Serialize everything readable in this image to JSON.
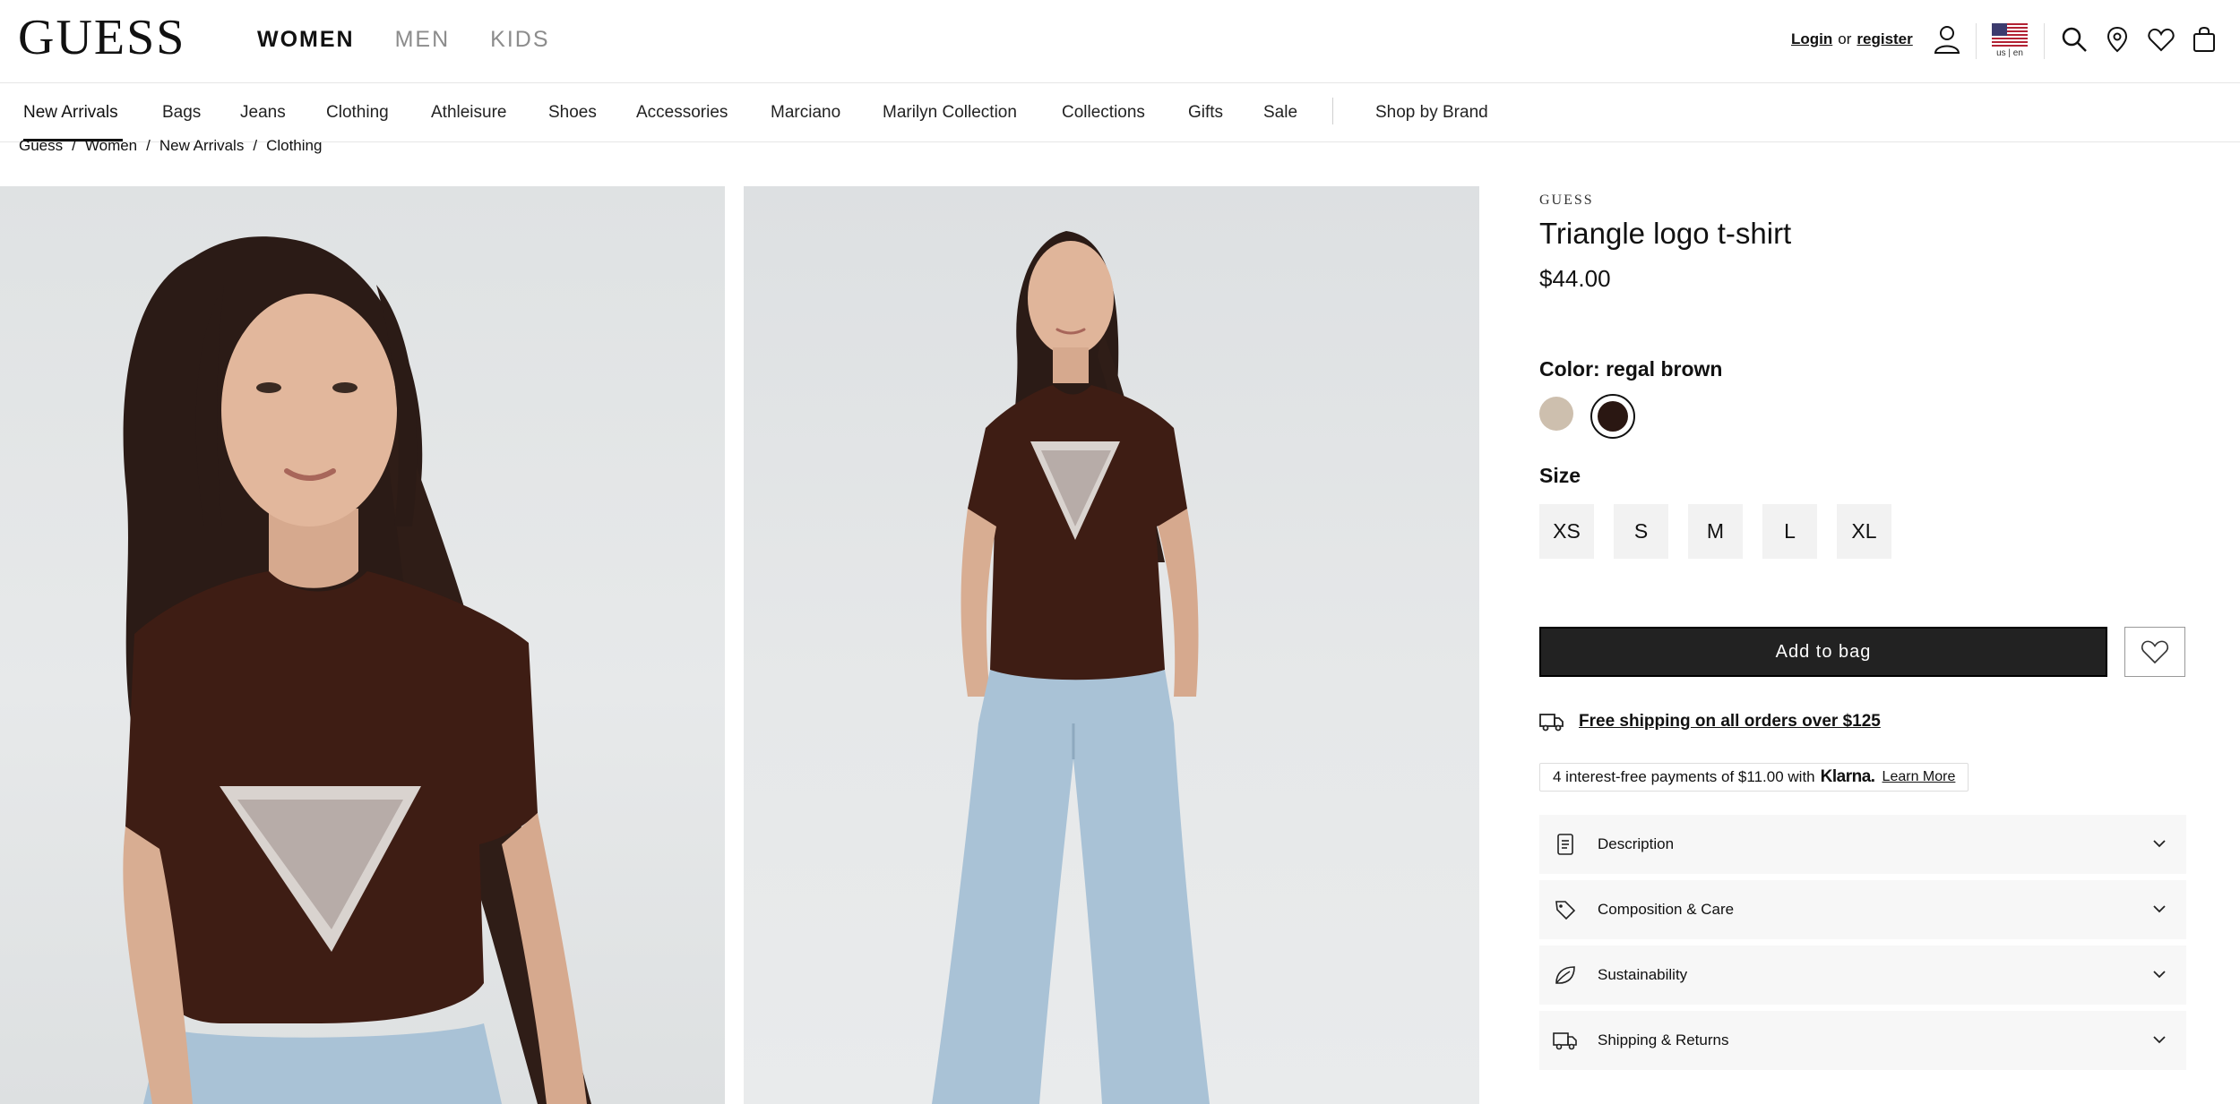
{
  "header": {
    "logo": "GUESS",
    "gender_tabs": [
      {
        "label": "WOMEN",
        "active": true
      },
      {
        "label": "MEN",
        "active": false
      },
      {
        "label": "KIDS",
        "active": false
      }
    ],
    "login_label": "Login",
    "or_label": "or",
    "register_label": "register",
    "locale_label": "us | en",
    "icons": [
      "account-icon",
      "us-flag-icon",
      "search-icon",
      "store-locator-icon",
      "wishlist-icon",
      "bag-icon"
    ]
  },
  "category_nav": {
    "items": [
      "New Arrivals",
      "Bags",
      "Jeans",
      "Clothing",
      "Athleisure",
      "Shoes",
      "Accessories",
      "Marciano",
      "Marilyn Collection",
      "Collections",
      "Gifts",
      "Sale"
    ],
    "active": "New Arrivals",
    "shop_by_brand": "Shop by Brand"
  },
  "breadcrumb": [
    "Guess",
    "Women",
    "New Arrivals",
    "Clothing"
  ],
  "product": {
    "brand": "GUESS",
    "title": "Triangle logo t-shirt",
    "price": "$44.00",
    "color_label": "Color: regal brown",
    "colors": [
      {
        "name": "beige",
        "hex": "#cdbfae",
        "selected": false
      },
      {
        "name": "regal brown",
        "hex": "#2a1712",
        "selected": true
      }
    ],
    "size_label": "Size",
    "sizes": [
      "XS",
      "S",
      "M",
      "L",
      "XL"
    ],
    "add_to_bag": "Add to bag",
    "shipping_text": "Free shipping on all orders over $125",
    "klarna": {
      "text": "4 interest-free payments of $11.00 with",
      "brand": "Klarna.",
      "learn_more": "Learn More"
    },
    "accordions": [
      {
        "label": "Description",
        "icon": "document-icon"
      },
      {
        "label": "Composition & Care",
        "icon": "tag-icon"
      },
      {
        "label": "Sustainability",
        "icon": "leaf-icon"
      },
      {
        "label": "Shipping & Returns",
        "icon": "truck-icon"
      }
    ]
  },
  "colors": {
    "button_dark": "#222222",
    "accordion_bg": "#f7f7f7",
    "shirt_brown": "#3e1d14",
    "jeans_blue": "#a9c2d6"
  }
}
